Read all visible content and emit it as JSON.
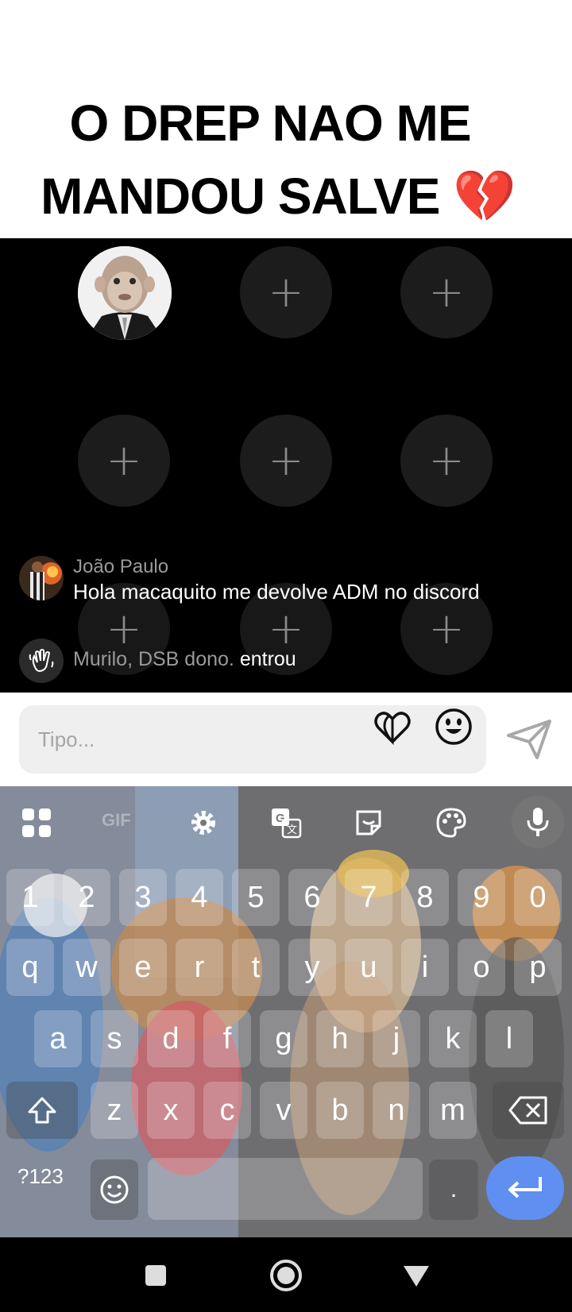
{
  "caption": {
    "line1": "O DREP NAO ME",
    "line2": "MANDOU SALVE 💔"
  },
  "seats": {
    "plus_symbol": "+",
    "count": 9,
    "host_icon": "monkey-avatar"
  },
  "chat": {
    "message": {
      "name": "João Paulo",
      "text": "Hola macaquito me devolve ADM no discord",
      "avatar_icon": "user-avatar"
    },
    "join": {
      "name": "Murilo, DSB dono.",
      "action": "entrou",
      "icon": "waving-hand-icon"
    }
  },
  "input": {
    "placeholder": "Tipo...",
    "heart_icon": "heart-icon",
    "emoji_icon": "smiley-icon",
    "send_icon": "send-icon"
  },
  "keyboard": {
    "toolbar": {
      "gif_label": "GIF",
      "icons": [
        "apps-grid-icon",
        "gear-icon",
        "translate-icon",
        "sticker-icon",
        "palette-icon",
        "microphone-icon"
      ]
    },
    "row_numbers": [
      "1",
      "2",
      "3",
      "4",
      "5",
      "6",
      "7",
      "8",
      "9",
      "0"
    ],
    "row_top": [
      "q",
      "w",
      "e",
      "r",
      "t",
      "y",
      "u",
      "i",
      "o",
      "p"
    ],
    "row_home": [
      "a",
      "s",
      "d",
      "f",
      "g",
      "h",
      "j",
      "k",
      "l"
    ],
    "row_bottom": [
      "z",
      "x",
      "c",
      "v",
      "b",
      "n",
      "m"
    ],
    "symbols_label": "?123",
    "period": ".",
    "shift_icon": "shift-icon",
    "backspace_icon": "backspace-icon",
    "emoji_icon": "smiley-icon",
    "enter_icon": "enter-arrow-icon"
  },
  "navbar": {
    "icons": [
      "recents-square-icon",
      "home-circle-icon",
      "back-triangle-icon"
    ]
  }
}
